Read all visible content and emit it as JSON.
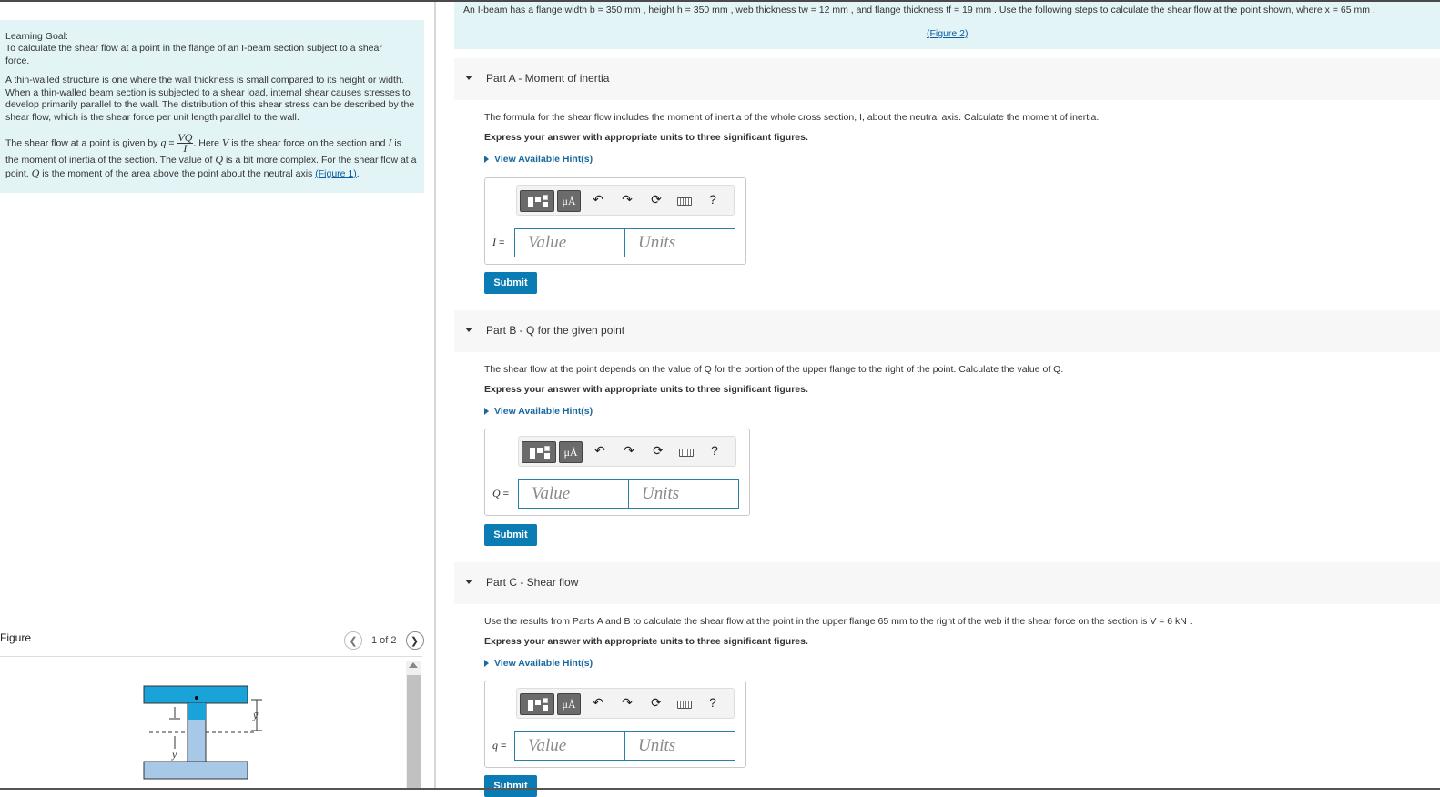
{
  "learning_goal": {
    "title": "Learning Goal:",
    "text": "To calculate the shear flow at a point in the flange of an I-beam section subject to a shear force.",
    "para2": "A thin-walled structure is one where the wall thickness is small compared to its height or width. When a thin-walled beam section is subjected to a shear load, internal shear causes stresses to develop primarily parallel to the wall. The distribution of this shear stress can be described by the shear flow, which is the shear force per unit length parallel to the wall.",
    "para3_a": "The shear flow at a point is given by",
    "formula_q": "q",
    "formula_num": "VQ",
    "formula_den": "I",
    "para3_b": ". Here",
    "sym_V": "V",
    "para3_c": "is the shear force on the section and",
    "sym_I": "I",
    "para3_d": "is the moment of inertia of the section. The value of",
    "sym_Q": "Q",
    "para3_e": "is a bit more complex. For the shear flow at a point,",
    "sym_Q2": "Q",
    "para3_f": "is the moment of the area above the point about the neutral axis",
    "figure1_link": "(Figure 1)",
    "para3_g": "."
  },
  "figure_panel": {
    "label": "Figure",
    "pager": "1 of 2",
    "prev_icon": "chevron-left-icon",
    "next_icon": "chevron-right-icon",
    "beam_label_y": "y",
    "beam_label_ybar": "ȳ"
  },
  "problem": {
    "text": "An I-beam has a flange width b = 350 mm , height h = 350 mm , web thickness tw = 12 mm , and flange thickness tf = 19 mm . Use the following steps to calculate the shear flow at the point shown, where x = 65 mm .",
    "figure_link": "(Figure 2)"
  },
  "toolbar": {
    "mu_label": "μÅ",
    "undo": "↶",
    "redo": "↷",
    "reset": "⟳",
    "help": "?"
  },
  "parts": [
    {
      "title": "Part A - Moment of inertia",
      "description": "The formula for the shear flow includes the moment of inertia of the whole cross section, I, about the neutral axis. Calculate the moment of inertia.",
      "instruction": "Express your answer with appropriate units to three significant figures.",
      "hint": "View Available Hint(s)",
      "variable": "I",
      "equals": "=",
      "value_placeholder": "Value",
      "units_placeholder": "Units",
      "submit": "Submit"
    },
    {
      "title": "Part B - Q for the given point",
      "description": "The shear flow at the point depends on the value of Q for the portion of the upper flange to the right of the point. Calculate the value of Q.",
      "instruction": "Express your answer with appropriate units to three significant figures.",
      "hint": "View Available Hint(s)",
      "variable": "Q",
      "equals": "=",
      "value_placeholder": "Value",
      "units_placeholder": "Units",
      "submit": "Submit"
    },
    {
      "title": "Part C - Shear flow",
      "description": "Use the results from Parts A and B to calculate the shear flow at the point in the upper flange 65 mm to the right of the web if the shear force on the section is V = 6 kN .",
      "instruction": "Express your answer with appropriate units to three significant figures.",
      "hint": "View Available Hint(s)",
      "variable": "q",
      "equals": "=",
      "value_placeholder": "Value",
      "units_placeholder": "Units",
      "submit": "Submit"
    }
  ],
  "colors": {
    "info_bg": "#e3f4f6",
    "submit_bg": "#0b7bb4",
    "beam_flange": "#1aa3d9",
    "beam_web": "#a8c8e8"
  }
}
